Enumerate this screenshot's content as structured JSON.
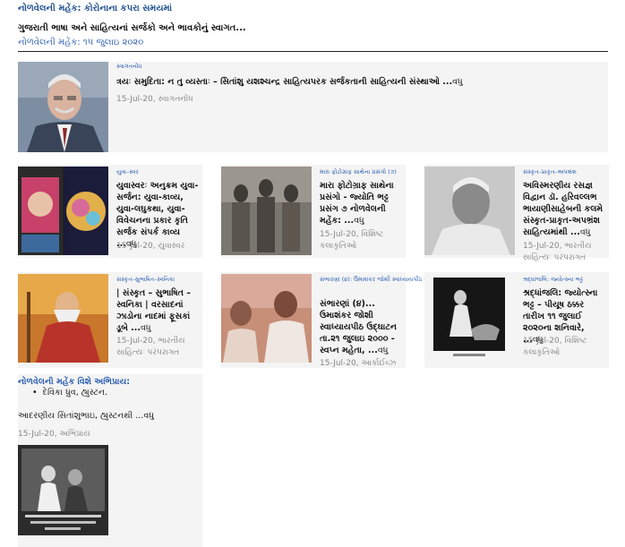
{
  "header": {
    "kicker": "નોળવેલની મહેંક: કોરોનાના કપરા સમયમાં",
    "intro": "ગુજરાતી ભાષા અને સાહિત્યનાં સર્જકો અને ભાવકોનું સ્વાગત...",
    "subline": "નોળવેલની મહેંક: ૧૫ જુલાઇ ૨૦૨૦"
  },
  "featured": {
    "category": "સ્વાગતનોંધ",
    "title": "ત્રયઃ સમુદિતા: ન તુ વ્યસ્તાઃ – સિતાંશુ યશશ્ચન્દ્ર સાહિત્યપરક સર્જકતાની સાહિત્યની સંસ્થાઓ ...",
    "more": "વધુ",
    "meta": "15-Jul-20, સ્વાગતનોંધ"
  },
  "cards": [
    {
      "category": "યુવા–સ્વર",
      "title": "યુવાસ્વરઃ અનુક્રમ યુવા-સર્જન: યુવા-કાવ્ય, યુવા-લઘુકથા, યુવા-વિવેચનના પ્રકાર કૃતિ સર્જક સંપર્ક કાવ્ય ...",
      "more": "વધુ",
      "meta": "15-Jul-20, યુવાસ્વર"
    },
    {
      "category": "મારા ફોટોગ્રાફ સાથેના પ્રસંગો (૭)",
      "title": "મારા ફોટોગ્રાફ સાથેના પ્રસંગો - જ્યોતિ ભટ્ટ પ્રસંગ ૭ નોળવેલની મહેંક: ...",
      "more": "વધુ",
      "meta": "15-Jul-20, વિશિષ્ટ કલાકૃતિઓ"
    },
    {
      "category": "સંસ્કૃત–પ્રાકૃત–અપભ્રંશ",
      "title": "અવિસ્મરણીય રસજ્ઞ વિદ્વાન ડૉ. હરિવલ્લભ ભાયાણીસાહેબની કલમે સંસ્કૃત-પ્રાકૃત-અપભ્રંશ સાહિત્યમાંથી ...",
      "more": "વધુ",
      "meta": "15-Jul-20, ભારતીય સાહિત્યઃ પરંપરાગત"
    },
    {
      "category": "સંસ્કૃત–સુભાષિત–સ્વનિકા",
      "title": "| સંસ્કૃત – સુભાષિત – સ્વનિકા | વરસાદનાં ઝાડોના નાદમાં ફૂસકાં ડૂબે ...",
      "more": "વધુ",
      "meta": "15-Jul-20, ભારતીય સાહિત્યઃ પરંપરાગત"
    },
    {
      "category": "સંભારણાં (૪): ઉમાશંકર જોશી સ્વાધ્યાયપીઠ ઉદ્ઘાટન કાર્યક્રમ",
      "title": "સંભારણાં (૪)... ઉમાશંકર જોશી સ્વાધ્યાયપીઠ ઉદ્ઘાટન તા.૨૧ જુલાઇ ૨૦૦૦ - સ્વપ્ન મહેતા, ...",
      "more": "વધુ",
      "meta": "15-Jul-20, આર્કાઈવ્ઝ"
    },
    {
      "category": "શ્રદ્ધાંજલિ: જ્યોત્સ્ના ભટ્ટ",
      "title": "શ્રદ્ધાંજલિ: જ્યોત્સ્ના ભટ્ટ – પીયૂષ ઠક્કર તારીખ ૧૧ જુલાઈ ૨૦૨૦ના શનિવારે, ...",
      "more": "વધુ",
      "meta": "15-Jul-20, વિશિષ્ટ કલાકૃતિઓ"
    }
  ],
  "opinions": {
    "heading": "નોળવેલની મહેંક વિશે અભિપ્રાય:",
    "bullet": "દેવિકા ધ્રુવ, હ્યુસ્ટન.",
    "text": "આદરણીય સિતાંશુભાઇ, હ્યુસ્ટનથી ...",
    "more": "વધુ",
    "meta": "15-Jul-20, અભિપ્રાય"
  },
  "colors": {
    "link": "#2a5db0",
    "card_bg": "#f4f4f4",
    "meta_gray": "#888888"
  }
}
